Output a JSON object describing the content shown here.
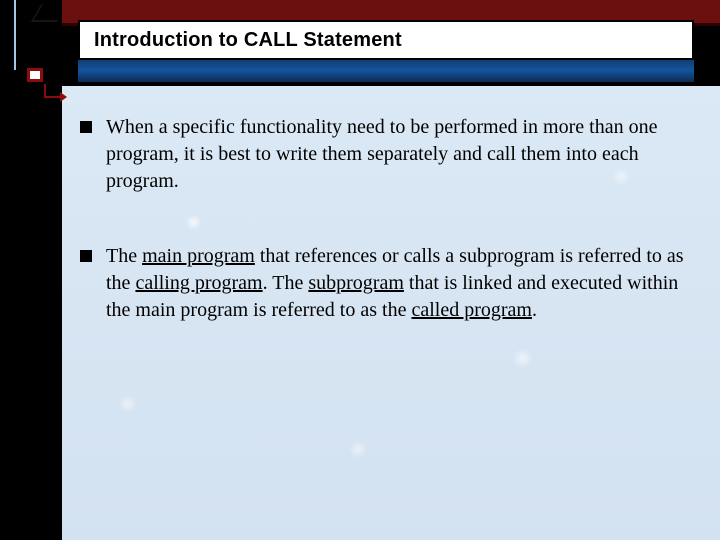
{
  "title": "Introduction to CALL Statement",
  "bullets": [
    {
      "pre1": "When a specific functionality need to be performed in more than one program, it is best to write them separately and call them into each program."
    },
    {
      "p2_a": "The ",
      "p2_u1": "main program",
      "p2_b": " that references or calls a subprogram is referred to as the ",
      "p2_u2": "calling program",
      "p2_c": ". The ",
      "p2_u3": "subprogram",
      "p2_d": " that is linked and executed within the main program is referred to as the ",
      "p2_u4": "called program",
      "p2_e": "."
    }
  ]
}
